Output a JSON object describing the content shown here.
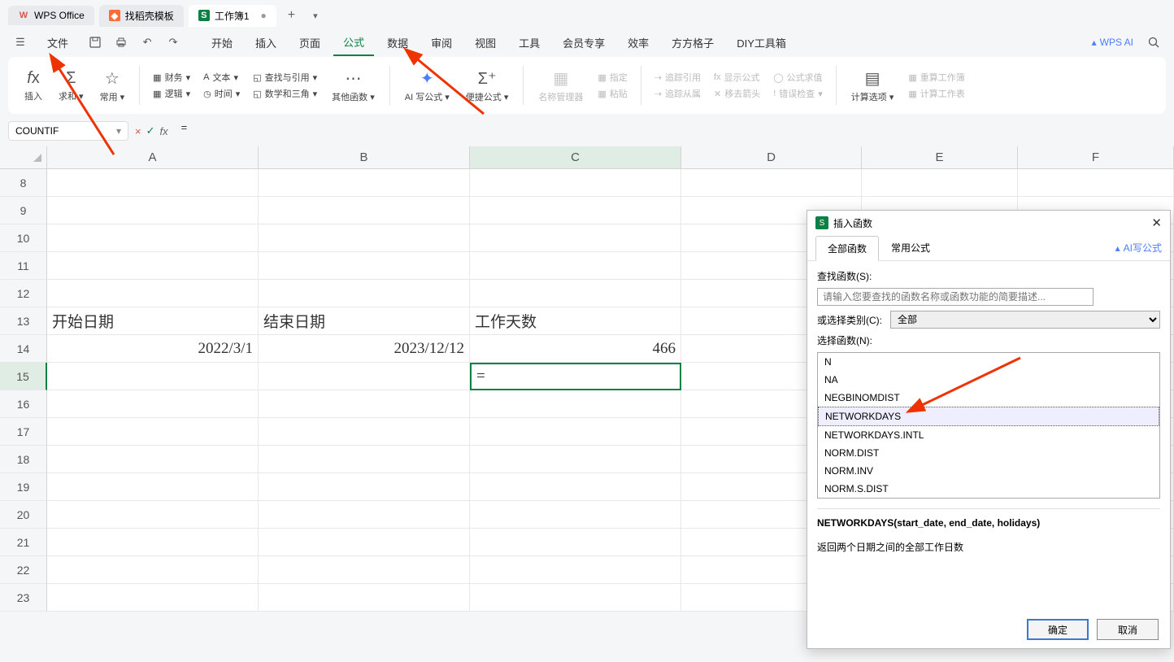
{
  "tabs": {
    "wps": "WPS Office",
    "template": "找稻壳模板",
    "workbook": "工作簿1"
  },
  "menu": {
    "file": "文件",
    "items": [
      "开始",
      "插入",
      "页面",
      "公式",
      "数据",
      "审阅",
      "视图",
      "工具",
      "会员专享",
      "效率",
      "方方格子",
      "DIY工具箱"
    ],
    "ai": "WPS AI"
  },
  "ribbon": {
    "insert": "插入",
    "sum": "求和",
    "common": "常用",
    "finance": "财务",
    "text": "文本",
    "lookup": "查找与引用",
    "logic": "逻辑",
    "time": "时间",
    "math": "数学和三角",
    "other": "其他函数",
    "ai_formula": "AI 写公式",
    "quick": "便捷公式",
    "name_mgr": "名称管理器",
    "paste": "粘贴",
    "specify": "指定",
    "trace_ref": "追踪引用",
    "trace_dep": "追踪从属",
    "show_formula": "显示公式",
    "remove_arrow": "移去箭头",
    "eval": "公式求值",
    "error_check": "错误检查",
    "calc_opt": "计算选项",
    "recalc_wb": "重算工作簿",
    "calc_sheet": "计算工作表"
  },
  "formula_bar": {
    "name_box": "COUNTIF",
    "value": "="
  },
  "sheet": {
    "cols": [
      "A",
      "B",
      "C",
      "D",
      "E",
      "F"
    ],
    "rows": [
      "8",
      "9",
      "10",
      "11",
      "12",
      "13",
      "14",
      "15",
      "16",
      "17",
      "18",
      "19",
      "20",
      "21",
      "22",
      "23"
    ],
    "A13": "开始日期",
    "B13": "结束日期",
    "C13": "工作天数",
    "A14": "2022/3/1",
    "B14": "2023/12/12",
    "C14": "466",
    "C15": "="
  },
  "dialog": {
    "title": "插入函数",
    "tab_all": "全部函数",
    "tab_common": "常用公式",
    "ai": "AI写公式",
    "search_label": "查找函数(S):",
    "search_placeholder": "请输入您要查找的函数名称或函数功能的简要描述...",
    "category_label": "或选择类别(C):",
    "category_value": "全部",
    "select_label": "选择函数(N):",
    "functions": [
      "N",
      "NA",
      "NEGBINOMDIST",
      "NETWORKDAYS",
      "NETWORKDAYS.INTL",
      "NORM.DIST",
      "NORM.INV",
      "NORM.S.DIST"
    ],
    "signature": "NETWORKDAYS(start_date, end_date, holidays)",
    "description": "返回两个日期之间的全部工作日数",
    "ok": "确定",
    "cancel": "取消"
  },
  "chart_data": null
}
